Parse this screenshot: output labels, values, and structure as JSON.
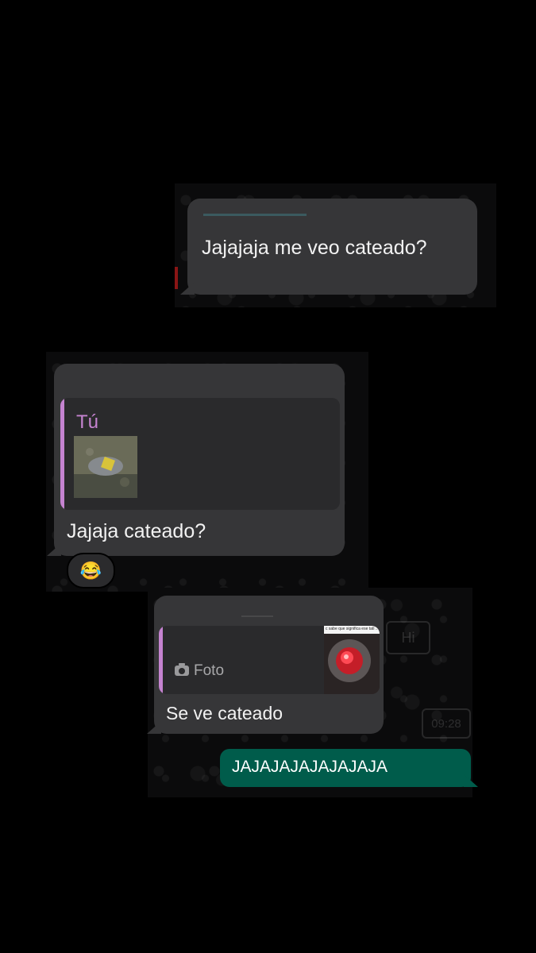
{
  "messages": [
    {
      "id": "m1",
      "text": "Jajajaja me veo cateado?"
    },
    {
      "id": "m2",
      "reply_author": "Tú",
      "reply_media": "photo-thumbnail",
      "text": "Jajaja cateado?",
      "reaction": "😂"
    },
    {
      "id": "m3",
      "reply_icon": "camera-icon",
      "reply_label": "Foto",
      "reply_thumb_caption": "c sabe que significa ese tati ...",
      "text": "Se ve cateado"
    },
    {
      "id": "m4",
      "text": "JAJAJAJAJAJAJAJA"
    }
  ],
  "colors": {
    "incoming_bubble": "#363638",
    "outgoing_bubble": "#005c4b",
    "quote_bar": "#c583d0",
    "background": "#000000"
  }
}
